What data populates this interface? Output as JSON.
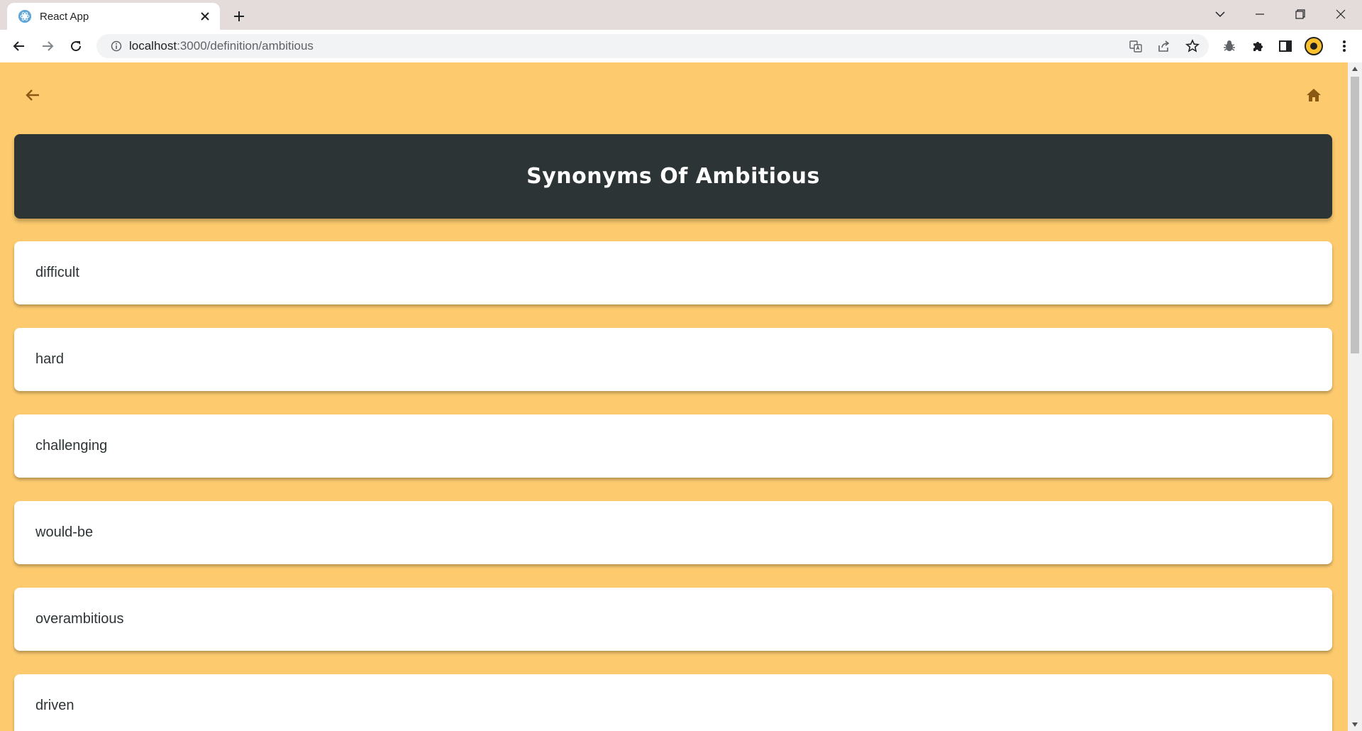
{
  "browser": {
    "tab_title": "React App",
    "url_host": "localhost",
    "url_rest": ":3000/definition/ambitious"
  },
  "page": {
    "title": "Synonyms Of Ambitious",
    "synonyms": [
      "difficult",
      "hard",
      "challenging",
      "would-be",
      "overambitious",
      "driven"
    ]
  },
  "colors": {
    "background": "#fdcb6e",
    "header": "#2d3436",
    "card": "#ffffff",
    "text": "#2d3436",
    "icon": "#8a5a14"
  },
  "icons": {
    "back": "arrow-left-icon",
    "home": "home-icon"
  }
}
